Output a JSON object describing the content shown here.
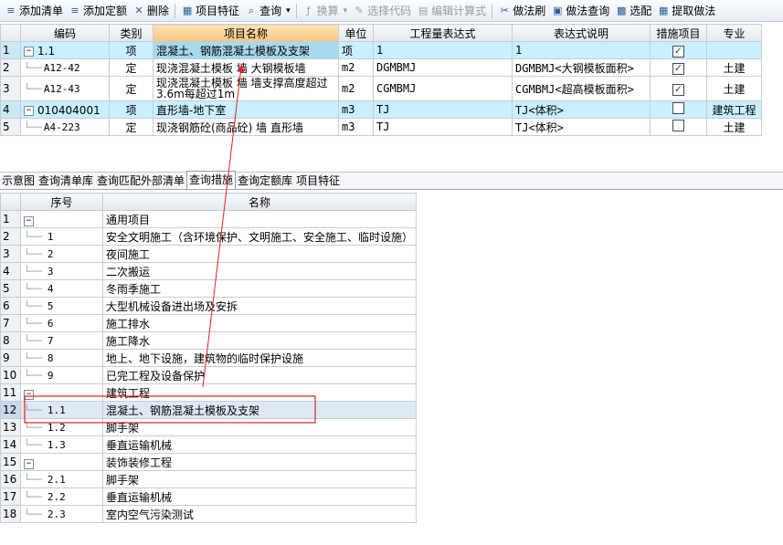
{
  "toolbar": {
    "items": [
      {
        "label": "添加清单",
        "icon": "add-list-icon",
        "glyph": "≡",
        "enabled": true
      },
      {
        "label": "添加定额",
        "icon": "add-quota-icon",
        "glyph": "≡",
        "enabled": true
      },
      {
        "label": "删除",
        "icon": "delete-icon",
        "glyph": "✕",
        "enabled": true
      },
      {
        "label": "项目特征",
        "icon": "project-feature-icon",
        "glyph": "▦",
        "enabled": true
      },
      {
        "label": "查询",
        "icon": "search-icon",
        "glyph": "⌕",
        "enabled": true
      },
      {
        "label": "换算",
        "icon": "convert-icon",
        "glyph": "ƒ",
        "enabled": false
      },
      {
        "label": "选择代码",
        "icon": "select-code-icon",
        "glyph": "✎",
        "enabled": false
      },
      {
        "label": "编辑计算式",
        "icon": "edit-formula-icon",
        "glyph": "▤",
        "enabled": false
      },
      {
        "label": "做法刷",
        "icon": "method-brush-icon",
        "glyph": "✂",
        "enabled": true
      },
      {
        "label": "做法查询",
        "icon": "method-query-icon",
        "glyph": "▣",
        "enabled": true
      },
      {
        "label": "选配",
        "icon": "select-match-icon",
        "glyph": "▩",
        "enabled": true
      },
      {
        "label": "提取做法",
        "icon": "extract-method-icon",
        "glyph": "▦",
        "enabled": true
      }
    ]
  },
  "top_grid": {
    "headers": [
      "编码",
      "类别",
      "项目名称",
      "单位",
      "工程量表达式",
      "表达式说明",
      "措施项目",
      "专业"
    ],
    "rows": [
      {
        "num": "1",
        "code": "1.1",
        "type": "项",
        "name": "混凝土、钢筋混凝土模板及支架",
        "unit": "项",
        "expr": "1",
        "desc": "1",
        "measure": true,
        "major": "",
        "style": "blue",
        "tree": "minus"
      },
      {
        "num": "2",
        "code": "A12-42",
        "type": "定",
        "name": "现浇混凝土模板 墙 大钢模板墙",
        "unit": "m2",
        "expr": "DGMBMJ",
        "desc": "DGMBMJ<大钢模板面积>",
        "measure": true,
        "major": "土建",
        "style": "white",
        "tree": "line"
      },
      {
        "num": "3",
        "code": "A12-43",
        "type": "定",
        "name": "现浇混凝土模板 墙 墙支撑高度超过3.6m每超过1m",
        "unit": "m2",
        "expr": "CGMBMJ",
        "desc": "CGMBMJ<超高模板面积>",
        "measure": true,
        "major": "土建",
        "style": "white",
        "tree": "line"
      },
      {
        "num": "4",
        "code": "010404001",
        "type": "项",
        "name": "直形墙-地下室",
        "unit": "m3",
        "expr": "TJ",
        "desc": "TJ<体积>",
        "measure": false,
        "major": "建筑工程",
        "style": "blue",
        "tree": "minus"
      },
      {
        "num": "5",
        "code": "A4-223",
        "type": "定",
        "name": "现浇钢筋砼(商品砼) 墙 直形墙",
        "unit": "m3",
        "expr": "TJ",
        "desc": "TJ<体积>",
        "measure": false,
        "major": "土建",
        "style": "white",
        "tree": "line"
      }
    ]
  },
  "tabs": [
    "示意图",
    "查询清单库",
    "查询匹配外部清单",
    "查询措施",
    "查询定额库",
    "项目特征"
  ],
  "active_tab": "查询措施",
  "bottom_grid": {
    "headers": [
      "序号",
      "名称"
    ],
    "rows": [
      {
        "num": "1",
        "seq": "",
        "name": "通用项目",
        "group": true
      },
      {
        "num": "2",
        "seq": "1",
        "name": "安全文明施工（含环境保护、文明施工、安全施工、临时设施）",
        "group": false
      },
      {
        "num": "3",
        "seq": "2",
        "name": "夜间施工",
        "group": false
      },
      {
        "num": "4",
        "seq": "3",
        "name": "二次搬运",
        "group": false
      },
      {
        "num": "5",
        "seq": "4",
        "name": "冬雨季施工",
        "group": false
      },
      {
        "num": "6",
        "seq": "5",
        "name": "大型机械设备进出场及安拆",
        "group": false
      },
      {
        "num": "7",
        "seq": "6",
        "name": "施工排水",
        "group": false
      },
      {
        "num": "8",
        "seq": "7",
        "name": "施工降水",
        "group": false
      },
      {
        "num": "9",
        "seq": "8",
        "name": "地上、地下设施，建筑物的临时保护设施",
        "group": false
      },
      {
        "num": "10",
        "seq": "9",
        "name": "已完工程及设备保护",
        "group": false
      },
      {
        "num": "11",
        "seq": "",
        "name": "建筑工程",
        "group": true
      },
      {
        "num": "12",
        "seq": "1.1",
        "name": "混凝土、钢筋混凝土模板及支架",
        "group": false,
        "selected": true
      },
      {
        "num": "13",
        "seq": "1.2",
        "name": "脚手架",
        "group": false
      },
      {
        "num": "14",
        "seq": "1.3",
        "name": "垂直运输机械",
        "group": false
      },
      {
        "num": "15",
        "seq": "",
        "name": "装饰装修工程",
        "group": true
      },
      {
        "num": "16",
        "seq": "2.1",
        "name": "脚手架",
        "group": false
      },
      {
        "num": "17",
        "seq": "2.2",
        "name": "垂直运输机械",
        "group": false
      },
      {
        "num": "18",
        "seq": "2.3",
        "name": "室内空气污染测试",
        "group": false
      }
    ]
  },
  "annotation_color": "#e02020",
  "accent": "#f7c67d"
}
